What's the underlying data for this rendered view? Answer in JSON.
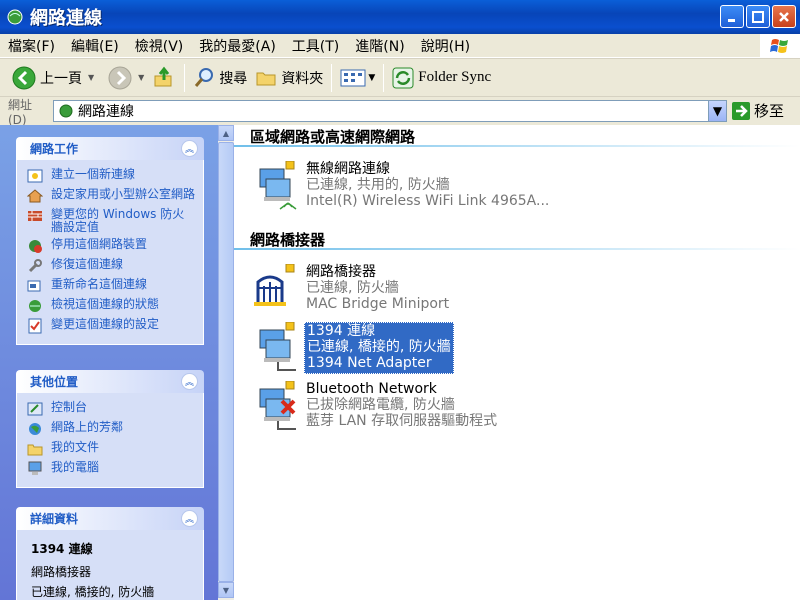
{
  "window": {
    "title": "網路連線"
  },
  "menu": [
    "檔案(F)",
    "編輯(E)",
    "檢視(V)",
    "我的最愛(A)",
    "工具(T)",
    "進階(N)",
    "說明(H)"
  ],
  "toolbar": {
    "back_label": "上一頁",
    "search_label": "搜尋",
    "folders_label": "資料夾",
    "folder_sync_label": "Folder Sync"
  },
  "address": {
    "label": "網址(D)",
    "value": "網路連線",
    "go_label": "移至"
  },
  "left_pane": {
    "network_tasks": {
      "title": "網路工作",
      "items": [
        "建立一個新連線",
        "設定家用或小型辦公室網路",
        "變更您的 Windows 防火牆設定值",
        "停用這個網路裝置",
        "修復這個連線",
        "重新命名這個連線",
        "檢視這個連線的狀態",
        "變更這個連線的設定"
      ]
    },
    "other_places": {
      "title": "其他位置",
      "items": [
        "控制台",
        "網路上的芳鄰",
        "我的文件",
        "我的電腦"
      ]
    },
    "details": {
      "title": "詳細資料",
      "name": "1394 連線",
      "type": "網路橋接器",
      "status": "已連線, 橋接的, 防火牆"
    }
  },
  "groups": [
    {
      "title": "區域網路或高速網際網路",
      "items": [
        {
          "name": "無線網路連線",
          "status": "已連線, 共用的, 防火牆",
          "device": "Intel(R) Wireless WiFi Link 4965A..."
        }
      ]
    },
    {
      "title": "網路橋接器",
      "items": [
        {
          "name": "網路橋接器",
          "status": "已連線, 防火牆",
          "device": "MAC Bridge Miniport"
        },
        {
          "name": "1394 連線",
          "status": "已連線, 橋接的, 防火牆",
          "device": "1394 Net Adapter"
        },
        {
          "name": "Bluetooth Network",
          "status": "已拔除網路電纜, 防火牆",
          "device": "藍芽 LAN 存取伺服器驅動程式"
        }
      ]
    }
  ],
  "colors": {
    "title_bar": "#0a4fcf",
    "link": "#215dc6",
    "selection": "#316ac5",
    "task_pane": "#6f8fe0"
  }
}
